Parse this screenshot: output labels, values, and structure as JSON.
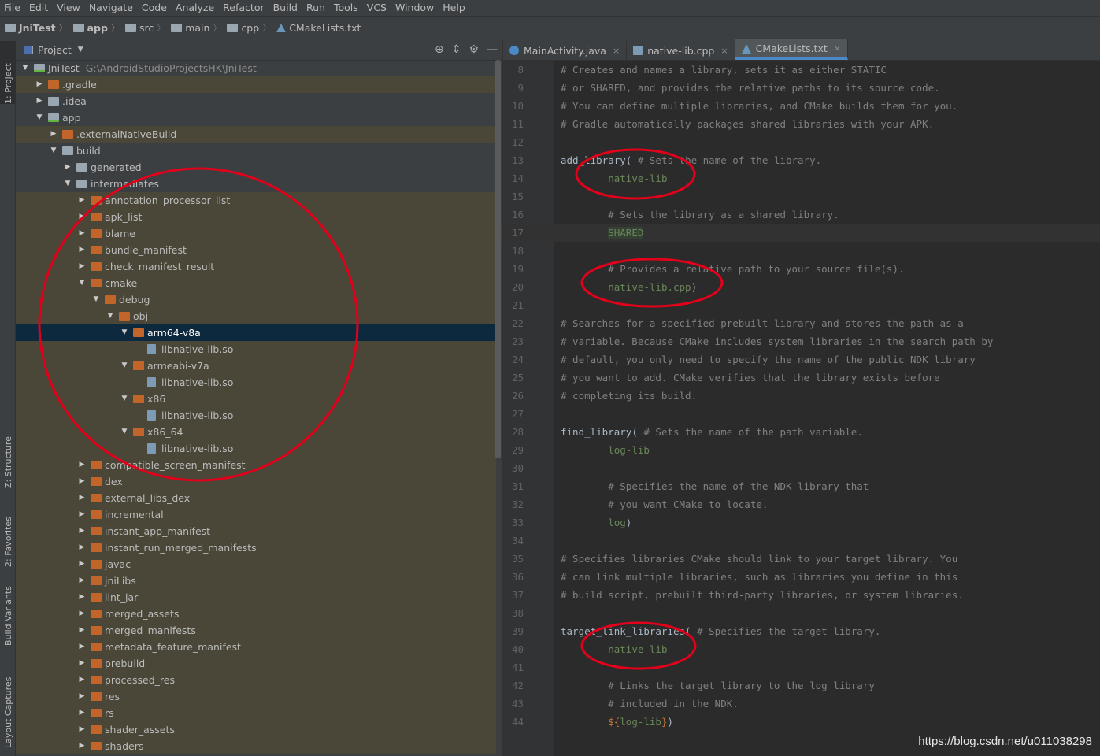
{
  "menu": [
    "File",
    "Edit",
    "View",
    "Navigate",
    "Code",
    "Analyze",
    "Refactor",
    "Build",
    "Run",
    "Tools",
    "VCS",
    "Window",
    "Help"
  ],
  "breadcrumb": [
    "JniTest",
    "app",
    "src",
    "main",
    "cpp",
    "CMakeLists.txt"
  ],
  "sidebar_tabs": {
    "project": "1: Project",
    "structure": "Z: Structure",
    "favorites": "2: Favorites",
    "build_variants": "Build Variants",
    "layout_captures": "Layout Captures"
  },
  "panel": {
    "title": "Project",
    "tools": [
      "⊕",
      "⇕",
      "⚙",
      "—"
    ]
  },
  "tree": [
    {
      "label": "JniTest",
      "path": "G:\\AndroidStudioProjectsHK\\JniTest",
      "depth": 0,
      "arrow": "down",
      "icon": "module"
    },
    {
      "label": ".gradle",
      "depth": 1,
      "arrow": "right",
      "icon": "orange",
      "hl": true
    },
    {
      "label": ".idea",
      "depth": 1,
      "arrow": "right",
      "icon": "plain"
    },
    {
      "label": "app",
      "depth": 1,
      "arrow": "down",
      "icon": "module"
    },
    {
      "label": ".externalNativeBuild",
      "depth": 2,
      "arrow": "right",
      "icon": "orange",
      "hl": true
    },
    {
      "label": "build",
      "depth": 2,
      "arrow": "down",
      "icon": "plain"
    },
    {
      "label": "generated",
      "depth": 3,
      "arrow": "right",
      "icon": "plain"
    },
    {
      "label": "intermediates",
      "depth": 3,
      "arrow": "down",
      "icon": "plain"
    },
    {
      "label": "annotation_processor_list",
      "depth": 4,
      "arrow": "right",
      "icon": "orange",
      "hl": true
    },
    {
      "label": "apk_list",
      "depth": 4,
      "arrow": "right",
      "icon": "orange",
      "hl": true
    },
    {
      "label": "blame",
      "depth": 4,
      "arrow": "right",
      "icon": "orange",
      "hl": true
    },
    {
      "label": "bundle_manifest",
      "depth": 4,
      "arrow": "right",
      "icon": "orange",
      "hl": true
    },
    {
      "label": "check_manifest_result",
      "depth": 4,
      "arrow": "right",
      "icon": "orange",
      "hl": true
    },
    {
      "label": "cmake",
      "depth": 4,
      "arrow": "down",
      "icon": "orange",
      "hl": true
    },
    {
      "label": "debug",
      "depth": 5,
      "arrow": "down",
      "icon": "orange",
      "hl": true
    },
    {
      "label": "obj",
      "depth": 6,
      "arrow": "down",
      "icon": "orange",
      "hl": true
    },
    {
      "label": "arm64-v8a",
      "depth": 7,
      "arrow": "down",
      "icon": "orange",
      "sel": true
    },
    {
      "label": "libnative-lib.so",
      "depth": 8,
      "arrow": "",
      "icon": "file",
      "hl": true
    },
    {
      "label": "armeabi-v7a",
      "depth": 7,
      "arrow": "down",
      "icon": "orange",
      "hl": true
    },
    {
      "label": "libnative-lib.so",
      "depth": 8,
      "arrow": "",
      "icon": "file",
      "hl": true
    },
    {
      "label": "x86",
      "depth": 7,
      "arrow": "down",
      "icon": "orange",
      "hl": true
    },
    {
      "label": "libnative-lib.so",
      "depth": 8,
      "arrow": "",
      "icon": "file",
      "hl": true
    },
    {
      "label": "x86_64",
      "depth": 7,
      "arrow": "down",
      "icon": "orange",
      "hl": true
    },
    {
      "label": "libnative-lib.so",
      "depth": 8,
      "arrow": "",
      "icon": "file",
      "hl": true
    },
    {
      "label": "compatible_screen_manifest",
      "depth": 4,
      "arrow": "right",
      "icon": "orange",
      "hl": true
    },
    {
      "label": "dex",
      "depth": 4,
      "arrow": "right",
      "icon": "orange",
      "hl": true
    },
    {
      "label": "external_libs_dex",
      "depth": 4,
      "arrow": "right",
      "icon": "orange",
      "hl": true
    },
    {
      "label": "incremental",
      "depth": 4,
      "arrow": "right",
      "icon": "orange",
      "hl": true
    },
    {
      "label": "instant_app_manifest",
      "depth": 4,
      "arrow": "right",
      "icon": "orange",
      "hl": true
    },
    {
      "label": "instant_run_merged_manifests",
      "depth": 4,
      "arrow": "right",
      "icon": "orange",
      "hl": true
    },
    {
      "label": "javac",
      "depth": 4,
      "arrow": "right",
      "icon": "orange",
      "hl": true
    },
    {
      "label": "jniLibs",
      "depth": 4,
      "arrow": "right",
      "icon": "orange",
      "hl": true
    },
    {
      "label": "lint_jar",
      "depth": 4,
      "arrow": "right",
      "icon": "orange",
      "hl": true
    },
    {
      "label": "merged_assets",
      "depth": 4,
      "arrow": "right",
      "icon": "orange",
      "hl": true
    },
    {
      "label": "merged_manifests",
      "depth": 4,
      "arrow": "right",
      "icon": "orange",
      "hl": true
    },
    {
      "label": "metadata_feature_manifest",
      "depth": 4,
      "arrow": "right",
      "icon": "orange",
      "hl": true
    },
    {
      "label": "prebuild",
      "depth": 4,
      "arrow": "right",
      "icon": "orange",
      "hl": true
    },
    {
      "label": "processed_res",
      "depth": 4,
      "arrow": "right",
      "icon": "orange",
      "hl": true
    },
    {
      "label": "res",
      "depth": 4,
      "arrow": "right",
      "icon": "orange",
      "hl": true
    },
    {
      "label": "rs",
      "depth": 4,
      "arrow": "right",
      "icon": "orange",
      "hl": true
    },
    {
      "label": "shader_assets",
      "depth": 4,
      "arrow": "right",
      "icon": "orange",
      "hl": true
    },
    {
      "label": "shaders",
      "depth": 4,
      "arrow": "right",
      "icon": "orange",
      "hl": true
    }
  ],
  "tabs": [
    {
      "label": "MainActivity.java",
      "icon": "java",
      "active": false
    },
    {
      "label": "native-lib.cpp",
      "icon": "cpp",
      "active": false
    },
    {
      "label": "CMakeLists.txt",
      "icon": "cmake",
      "active": true
    }
  ],
  "tab_close": "×",
  "code": [
    {
      "n": "8",
      "parts": [
        [
          "c",
          "# Creates and names a library, sets it as either STATIC"
        ]
      ]
    },
    {
      "n": "9",
      "parts": [
        [
          "c",
          "# or SHARED, and provides the relative paths to its source code."
        ]
      ]
    },
    {
      "n": "10",
      "parts": [
        [
          "c",
          "# You can define multiple libraries, and CMake builds them for you."
        ]
      ]
    },
    {
      "n": "11",
      "parts": [
        [
          "c",
          "# Gradle automatically packages shared libraries with your APK."
        ]
      ]
    },
    {
      "n": "12",
      "parts": []
    },
    {
      "n": "13",
      "parts": [
        [
          "f",
          "add_library"
        ],
        [
          "k",
          "( "
        ],
        [
          "c",
          "# Sets the name of the library."
        ]
      ]
    },
    {
      "n": "14",
      "parts": [
        [
          "k",
          "        "
        ],
        [
          "s",
          "native-lib"
        ]
      ]
    },
    {
      "n": "15",
      "parts": []
    },
    {
      "n": "16",
      "parts": [
        [
          "k",
          "        "
        ],
        [
          "c",
          "# Sets the library as a shared library."
        ]
      ]
    },
    {
      "n": "17",
      "parts": [
        [
          "k",
          "        "
        ],
        [
          "sh",
          "SHARED"
        ]
      ],
      "caret": true
    },
    {
      "n": "18",
      "parts": []
    },
    {
      "n": "19",
      "parts": [
        [
          "k",
          "        "
        ],
        [
          "c",
          "# Provides a relative path to your source file(s)."
        ]
      ]
    },
    {
      "n": "20",
      "parts": [
        [
          "k",
          "        "
        ],
        [
          "s",
          "native-lib.cpp"
        ],
        [
          "k",
          ")"
        ]
      ]
    },
    {
      "n": "21",
      "parts": []
    },
    {
      "n": "22",
      "parts": [
        [
          "c",
          "# Searches for a specified prebuilt library and stores the path as a"
        ]
      ]
    },
    {
      "n": "23",
      "parts": [
        [
          "c",
          "# variable. Because CMake includes system libraries in the search path by"
        ]
      ]
    },
    {
      "n": "24",
      "parts": [
        [
          "c",
          "# default, you only need to specify the name of the public NDK library"
        ]
      ]
    },
    {
      "n": "25",
      "parts": [
        [
          "c",
          "# you want to add. CMake verifies that the library exists before"
        ]
      ]
    },
    {
      "n": "26",
      "parts": [
        [
          "c",
          "# completing its build."
        ]
      ]
    },
    {
      "n": "27",
      "parts": []
    },
    {
      "n": "28",
      "parts": [
        [
          "f",
          "find_library"
        ],
        [
          "k",
          "( "
        ],
        [
          "c",
          "# Sets the name of the path variable."
        ]
      ]
    },
    {
      "n": "29",
      "parts": [
        [
          "k",
          "        "
        ],
        [
          "s",
          "log-lib"
        ]
      ]
    },
    {
      "n": "30",
      "parts": []
    },
    {
      "n": "31",
      "parts": [
        [
          "k",
          "        "
        ],
        [
          "c",
          "# Specifies the name of the NDK library that"
        ]
      ]
    },
    {
      "n": "32",
      "parts": [
        [
          "k",
          "        "
        ],
        [
          "c",
          "# you want CMake to locate."
        ]
      ]
    },
    {
      "n": "33",
      "parts": [
        [
          "k",
          "        "
        ],
        [
          "s",
          "log"
        ],
        [
          "k",
          ")"
        ]
      ]
    },
    {
      "n": "34",
      "parts": []
    },
    {
      "n": "35",
      "parts": [
        [
          "c",
          "# Specifies libraries CMake should link to your target library. You"
        ]
      ]
    },
    {
      "n": "36",
      "parts": [
        [
          "c",
          "# can link multiple libraries, such as libraries you define in this"
        ]
      ]
    },
    {
      "n": "37",
      "parts": [
        [
          "c",
          "# build script, prebuilt third-party libraries, or system libraries."
        ]
      ]
    },
    {
      "n": "38",
      "parts": []
    },
    {
      "n": "39",
      "parts": [
        [
          "f",
          "target_link_libraries"
        ],
        [
          "k",
          "( "
        ],
        [
          "c",
          "# Specifies the target library."
        ]
      ]
    },
    {
      "n": "40",
      "parts": [
        [
          "k",
          "        "
        ],
        [
          "s",
          "native-lib"
        ]
      ]
    },
    {
      "n": "41",
      "parts": []
    },
    {
      "n": "42",
      "parts": [
        [
          "k",
          "        "
        ],
        [
          "c",
          "# Links the target library to the log library"
        ]
      ]
    },
    {
      "n": "43",
      "parts": [
        [
          "k",
          "        "
        ],
        [
          "c",
          "# included in the NDK."
        ]
      ]
    },
    {
      "n": "44",
      "parts": [
        [
          "k",
          "        "
        ],
        [
          "v",
          "${"
        ],
        [
          "s",
          "log-lib"
        ],
        [
          "v",
          "}"
        ],
        [
          "k",
          ")"
        ]
      ]
    }
  ],
  "watermark": "https://blog.csdn.net/u011038298",
  "colors": {
    "annotation": "#e3001b",
    "selection": "#0d293e",
    "folder": "#c1652b",
    "comment": "#808080",
    "string": "#6a8759"
  }
}
